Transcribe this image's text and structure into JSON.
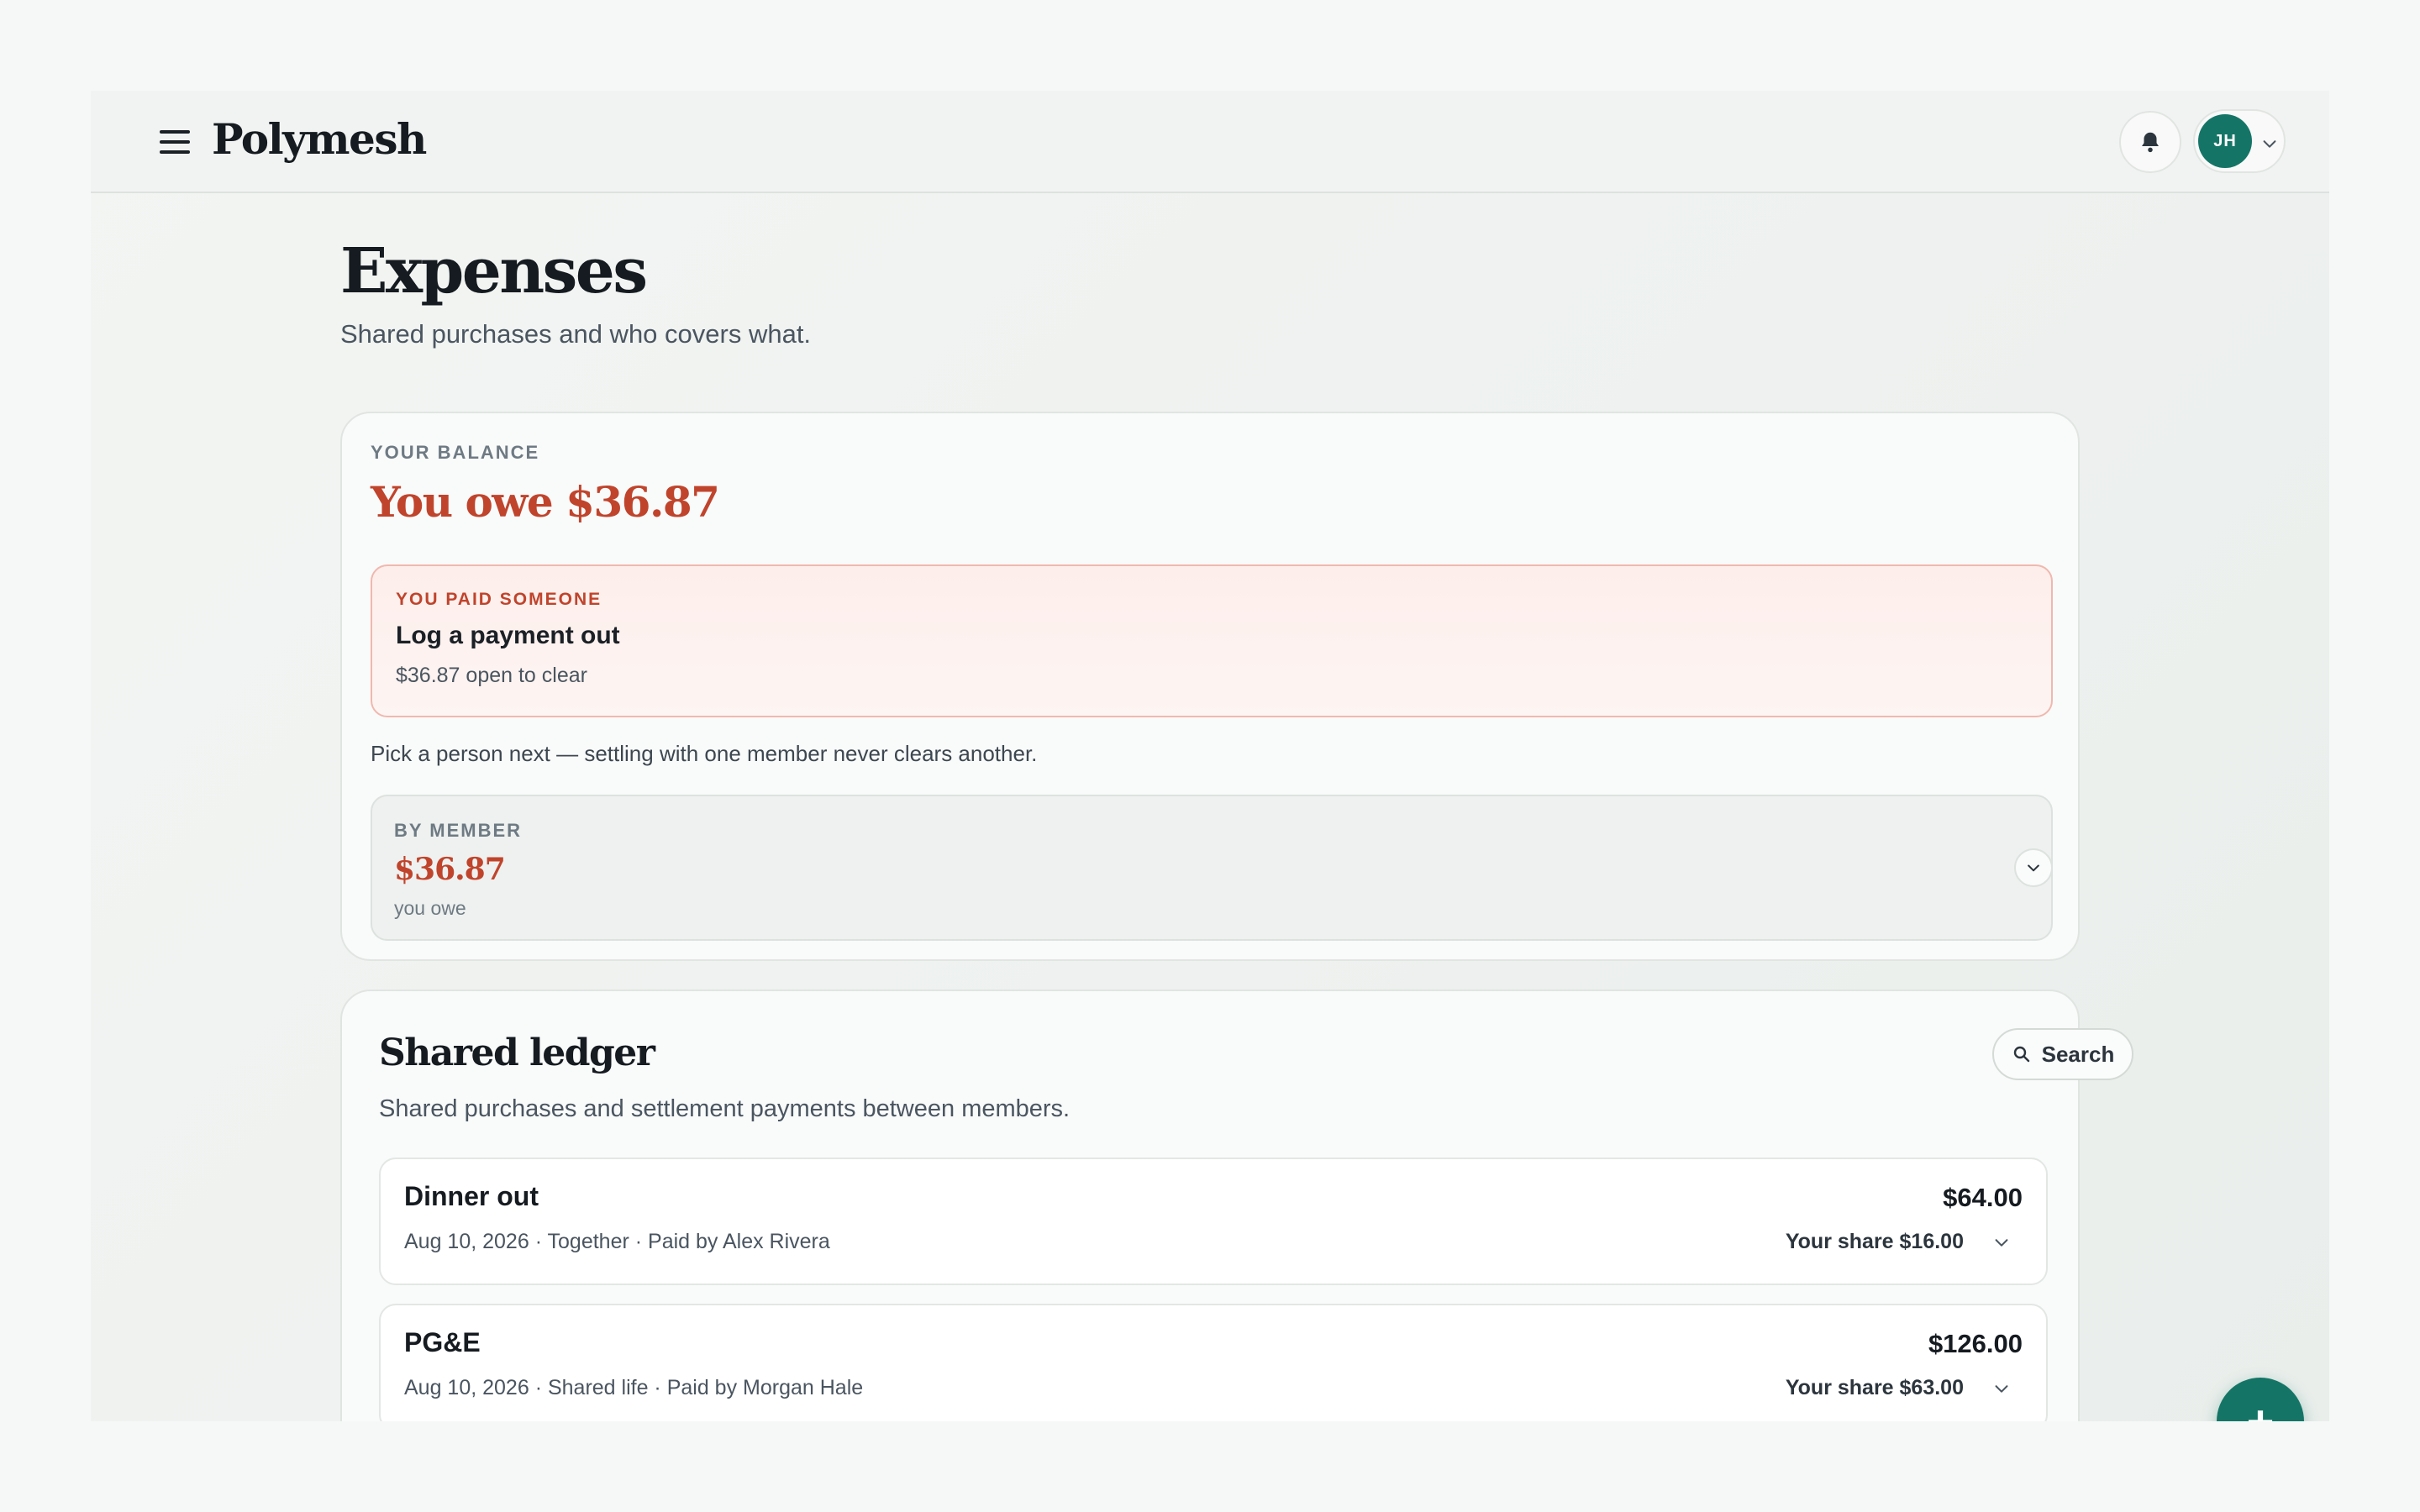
{
  "app": {
    "brand": "Polymesh"
  },
  "header": {
    "avatar_initials": "JH"
  },
  "page": {
    "title": "Expenses",
    "subtitle": "Shared purchases and who covers what."
  },
  "balance": {
    "label": "YOUR BALANCE",
    "amount_text": "You owe $36.87",
    "payment_card": {
      "eyebrow": "YOU PAID SOMEONE",
      "title": "Log a payment out",
      "subtitle": "$36.87 open to clear"
    },
    "hint": "Pick a person next — settling with one member never clears another.",
    "by_member": {
      "eyebrow": "BY MEMBER",
      "amount": "$36.87",
      "caption": "you owe"
    }
  },
  "ledger": {
    "title": "Shared ledger",
    "subtitle": "Shared purchases and settlement payments between members.",
    "search_label": "Search",
    "rows": [
      {
        "title": "Dinner out",
        "meta": "Aug 10, 2026 · Together · Paid by Alex Rivera",
        "total": "$64.00",
        "share": "Your share $16.00"
      },
      {
        "title": "PG&E",
        "meta": "Aug 10, 2026 · Shared life · Paid by Morgan Hale",
        "total": "$126.00",
        "share": "Your share $63.00"
      }
    ]
  },
  "fab": {
    "label": "+"
  },
  "colors": {
    "accent": "#147567",
    "owe": "#c0442c",
    "pay_border": "#f0b8ae",
    "pay_bg": "#fdeeeb"
  }
}
